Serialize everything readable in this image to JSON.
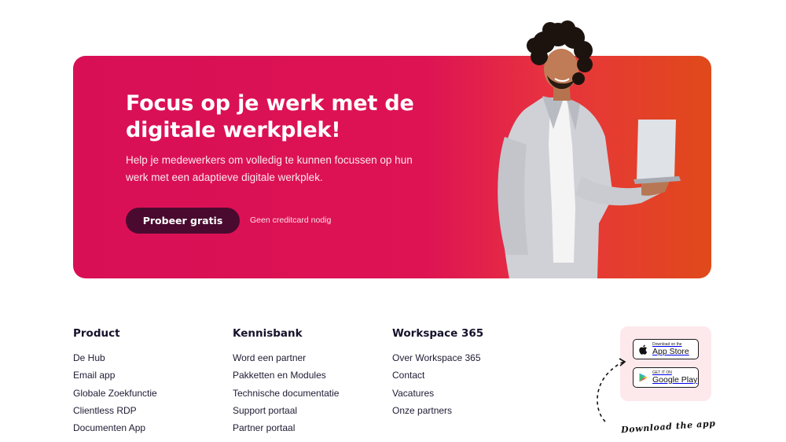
{
  "hero": {
    "title": "Focus op je werk met de digitale werkplek!",
    "subtitle": "Help je medewerkers om volledig te kunnen focussen op hun werk met een adaptieve digitale werkplek.",
    "cta_label": "Probeer gratis",
    "cta_note": "Geen creditcard nodig",
    "colors": {
      "gradient_start": "#d90f56",
      "gradient_end": "#e04a1a",
      "cta_bg": "#4a0a2f"
    }
  },
  "footer": {
    "columns": [
      {
        "heading": "Product",
        "links": [
          "De Hub",
          "Email app",
          "Globale Zoekfunctie",
          "Clientless RDP",
          "Documenten App"
        ]
      },
      {
        "heading": "Kennisbank",
        "links": [
          "Word een partner",
          "Pakketten en Modules",
          "Technische documentatie",
          "Support portaal",
          "Partner portaal"
        ]
      },
      {
        "heading": "Workspace 365",
        "links": [
          "Over Workspace 365",
          "Contact",
          "Vacatures",
          "Onze partners"
        ]
      }
    ],
    "app": {
      "appstore_small": "Download on the",
      "appstore_big": "App Store",
      "gplay_small": "GET IT ON",
      "gplay_big": "Google Play",
      "download_note": "Download the app",
      "icons": [
        "apple-icon",
        "google-play-icon",
        "dashed-arrow-icon"
      ]
    }
  }
}
